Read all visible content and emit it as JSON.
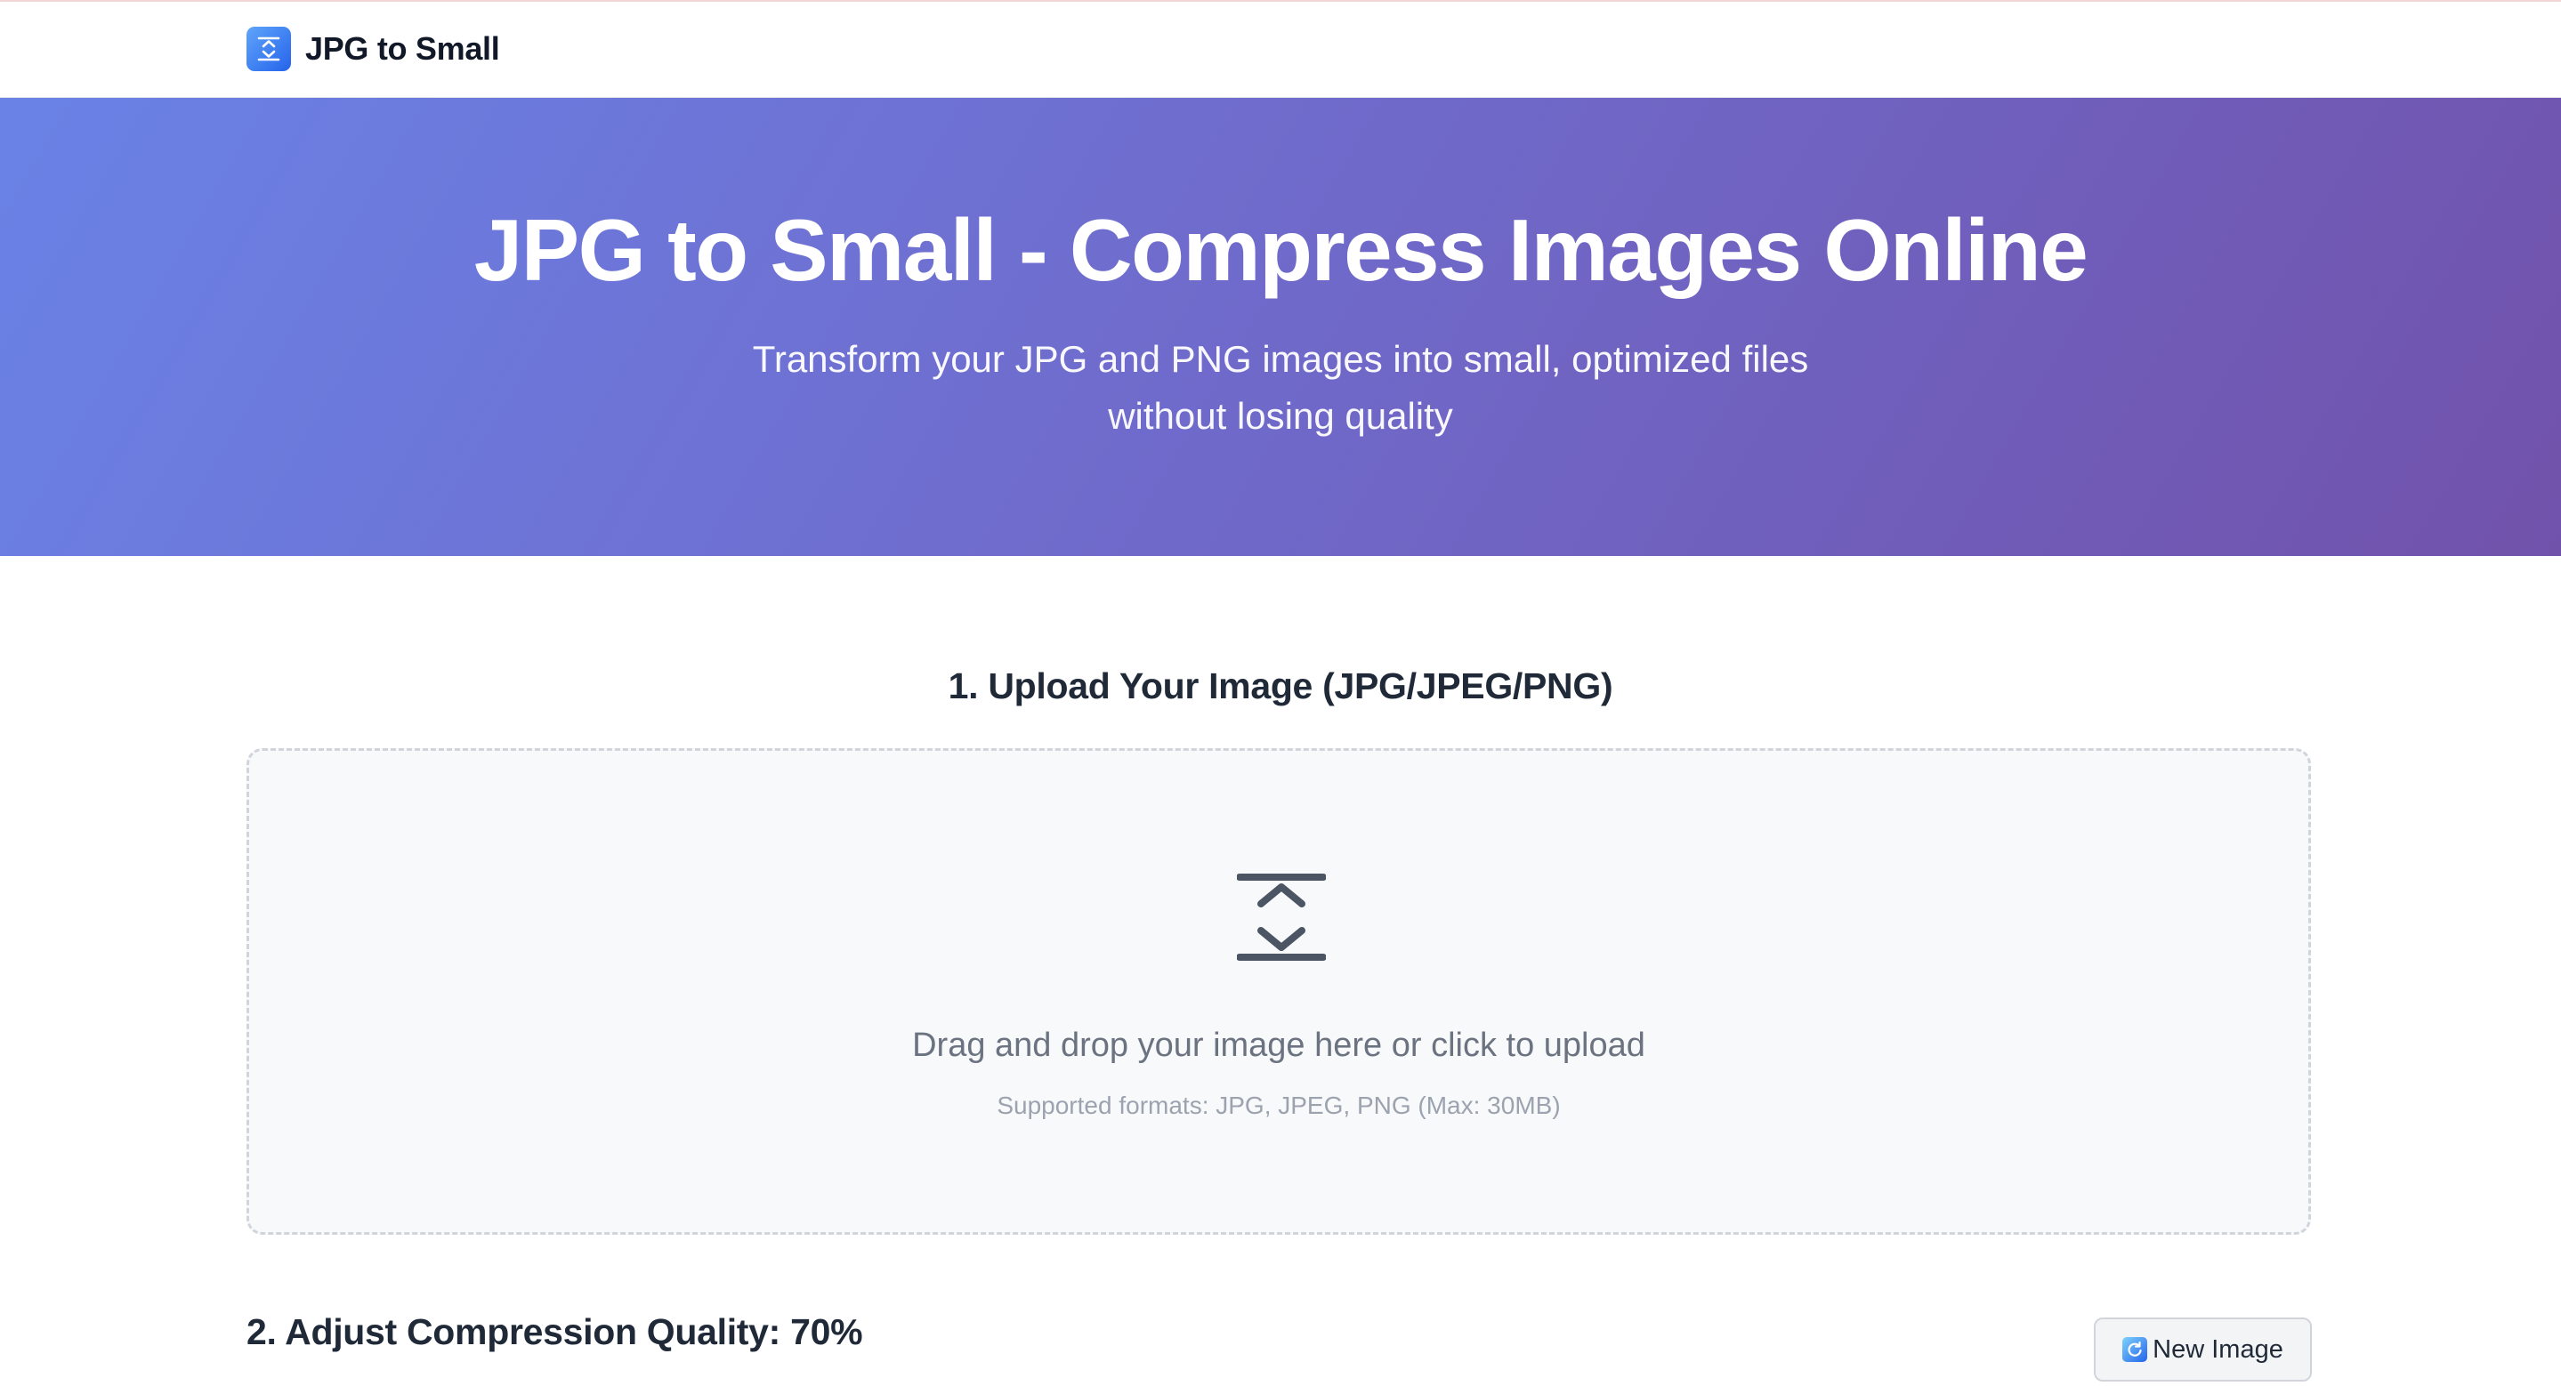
{
  "navbar": {
    "brand": "JPG to Small",
    "logo_icon": "compress-icon"
  },
  "hero": {
    "title": "JPG to Small - Compress Images Online",
    "subtitle": "Transform your JPG and PNG images into small, optimized files without losing quality"
  },
  "upload": {
    "heading": "1. Upload Your Image (JPG/JPEG/PNG)",
    "icon": "compress-icon",
    "prompt": "Drag and drop your image here or click to upload",
    "formats": "Supported formats: JPG, JPEG, PNG (Max: 30MB)"
  },
  "quality": {
    "heading": "2. Adjust Compression Quality: 70%",
    "value_percent": 70
  },
  "new_image_button": {
    "label": "New Image",
    "icon": "refresh-icon"
  },
  "colors": {
    "hero_gradient_start": "#6a82e6",
    "hero_gradient_end": "#7152ab",
    "logo_blue": "#3b82f6"
  }
}
